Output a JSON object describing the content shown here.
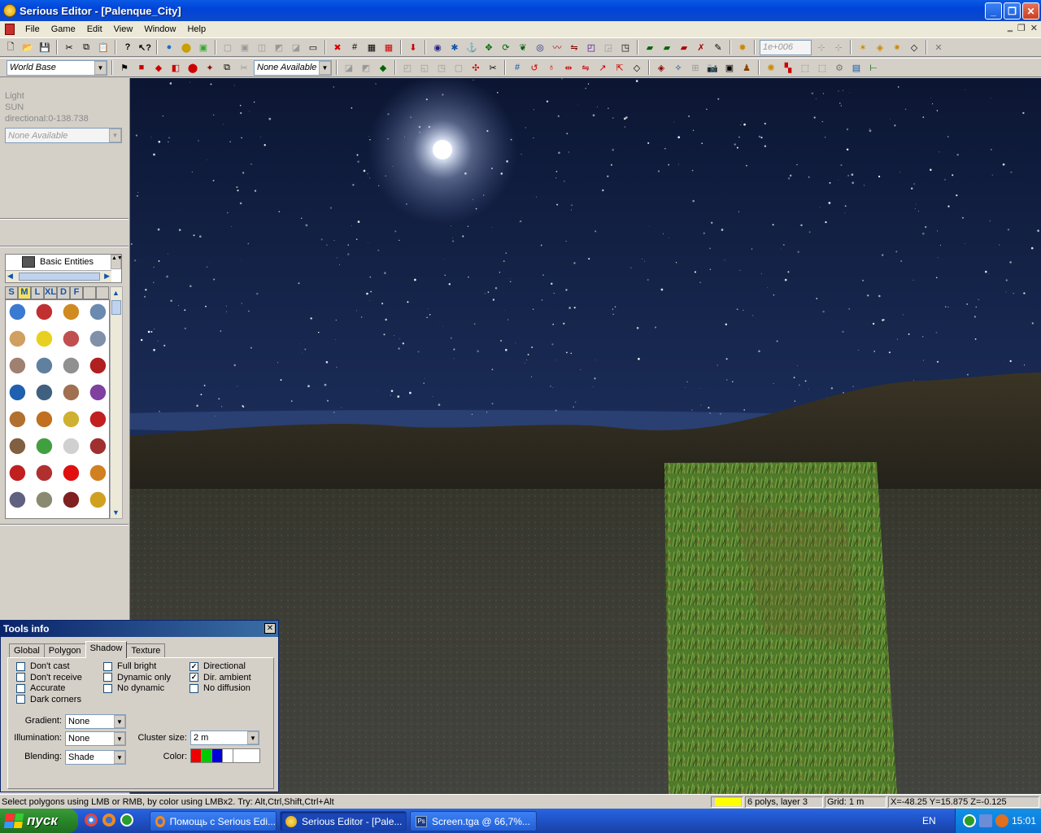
{
  "window": {
    "title": "Serious Editor - [Palenque_City]"
  },
  "menu": [
    "File",
    "Game",
    "Edit",
    "View",
    "Window",
    "Help"
  ],
  "toolbar": {
    "world_base": "World Base",
    "none_available": "None Available",
    "precision": "1e+006",
    "row1_icons": [
      "new-icon",
      "open-icon",
      "save-icon",
      "cut-icon",
      "copy-icon",
      "paste-icon",
      "help-icon",
      "context-help-icon",
      "globe-icon",
      "entities-icon",
      "picture-icon",
      "csg-icon",
      "csg-icon",
      "csg-icon",
      "csg-icon",
      "csg-icon",
      "screen-icon",
      "marker-icon",
      "grid-icon",
      "grid-icon",
      "grid-icon",
      "arrow-down-icon",
      "tool-icon",
      "tool-icon",
      "tool-icon",
      "tool-icon",
      "tool-icon",
      "tool-icon",
      "tool-icon",
      "tool-icon",
      "tool-icon",
      "tool-icon",
      "tool-icon",
      "layer-icon",
      "layer-icon",
      "layer-icon",
      "layer-icon",
      "layer-icon",
      "layer-icon"
    ],
    "row2_icons": [
      "entity-icon",
      "brush-icon",
      "brush-icon",
      "brush-icon",
      "brush-icon",
      "brush-icon",
      "brush-icon",
      "brush-icon"
    ]
  },
  "left": {
    "light_label": "Light",
    "light_name": "SUN",
    "light_info": "directional:0-138.738",
    "light_combo": "None Available",
    "browser_item": "Basic Entities",
    "size_tabs": [
      "S",
      "M",
      "L",
      "XL",
      "D",
      "F"
    ]
  },
  "tools_info": {
    "title": "Tools info",
    "tabs": [
      "Global",
      "Polygon",
      "Shadow",
      "Texture"
    ],
    "selected_tab": "Shadow",
    "col1": [
      {
        "label": "Don't cast",
        "checked": false
      },
      {
        "label": "Don't receive",
        "checked": false
      },
      {
        "label": "Accurate",
        "checked": false
      },
      {
        "label": "Dark corners",
        "checked": false
      }
    ],
    "col2": [
      {
        "label": "Full bright",
        "checked": false
      },
      {
        "label": "Dynamic only",
        "checked": false
      },
      {
        "label": "No dynamic",
        "checked": false
      }
    ],
    "col3": [
      {
        "label": "Directional",
        "checked": true
      },
      {
        "label": "Dir. ambient",
        "checked": true
      },
      {
        "label": "No diffusion",
        "checked": false
      }
    ],
    "gradient_label": "Gradient:",
    "gradient_value": "None",
    "illumination_label": "Illumination:",
    "illumination_value": "None",
    "blending_label": "Blending:",
    "blending_value": "Shade",
    "cluster_label": "Cluster size:",
    "cluster_value": "2 m",
    "color_label": "Color:"
  },
  "status": {
    "hint": "Select polygons using LMB or RMB, by color using LMBx2. Try: Alt,Ctrl,Shift,Ctrl+Alt",
    "polys": "6 polys, layer 3",
    "grid": "Grid: 1 m",
    "coords": "X=-48.25 Y=15.875 Z=-0.125",
    "swatch_color": "#ffff00"
  },
  "taskbar": {
    "start": "пуск",
    "tasks": [
      "Помощь с Serious Edi...",
      "Serious Editor - [Pale...",
      "Screen.tga @ 66,7%..."
    ],
    "lang": "EN",
    "time": "15:01"
  }
}
